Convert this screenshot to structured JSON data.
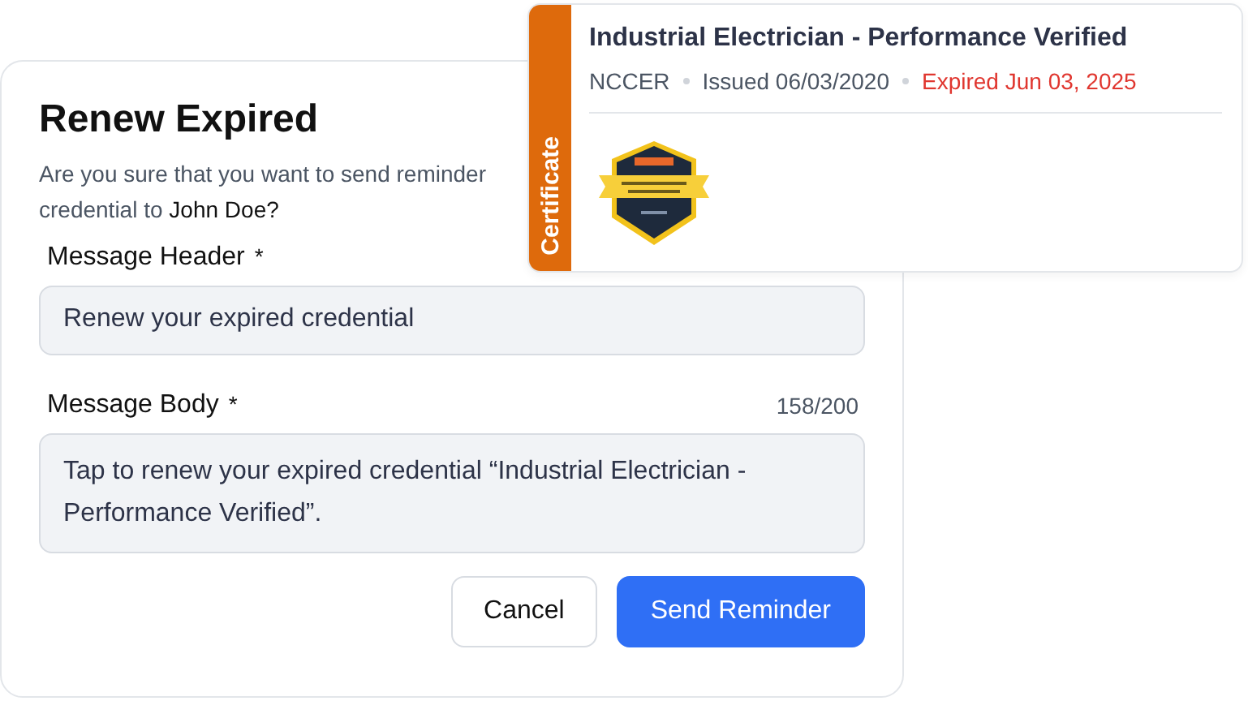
{
  "dialog": {
    "title": "Renew Expired",
    "subtitle_lines": [
      "Are you sure that you want to send reminder",
      "credential to **John Doe?**"
    ],
    "fields": [
      {
        "label": "Message Header",
        "required_mark": "*",
        "value": "Renew your expired credential",
        "kind": "input"
      },
      {
        "label": "Message Body",
        "required_mark": "*",
        "counter": "158/200",
        "value": "Tap to renew your expired credential “Industrial Electrician - Performance Verified”.",
        "kind": "textarea"
      }
    ],
    "buttons": [
      {
        "label": "Cancel",
        "kind": "secondary"
      },
      {
        "label": "Send Reminder",
        "kind": "primary"
      }
    ]
  },
  "certificate": {
    "type_label": "Certificate",
    "title": "Industrial Electrician - Performance Verified",
    "issuer": "NCCER",
    "issued": "Issued 06/03/2020",
    "expiry": "Expired Jun 03, 2025",
    "expired": true
  }
}
